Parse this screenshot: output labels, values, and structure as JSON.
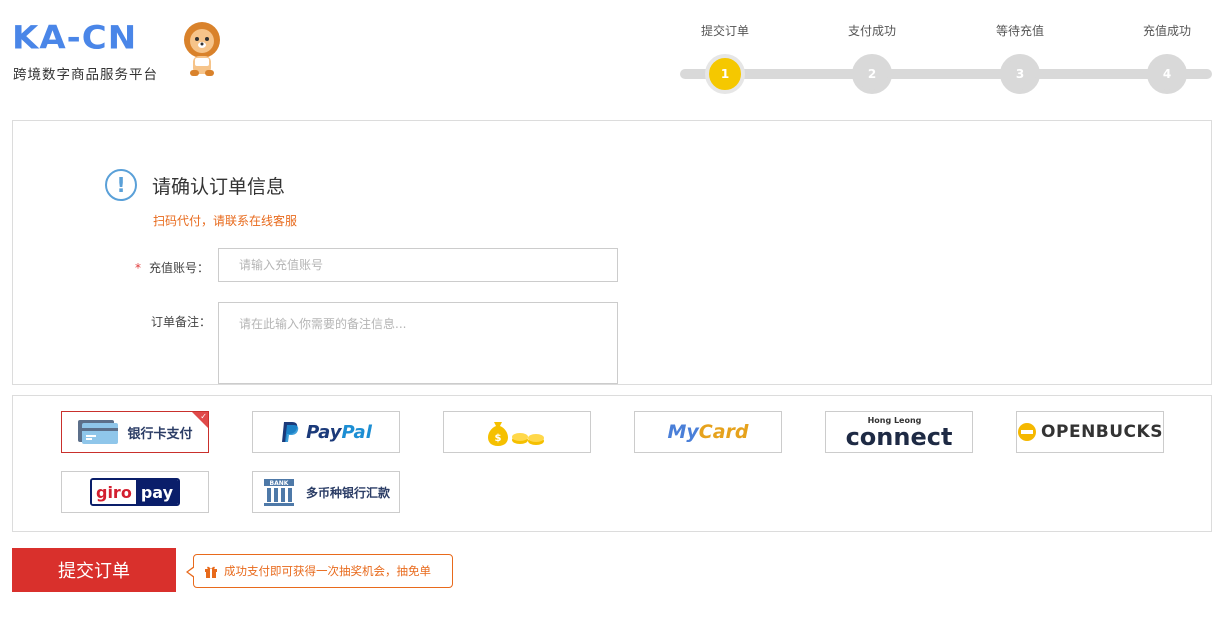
{
  "brand": {
    "logo_text": "KA-CN",
    "subtitle": "跨境数字商品服务平台"
  },
  "steps": [
    {
      "label": "提交订单",
      "number": "1",
      "active": true
    },
    {
      "label": "支付成功",
      "number": "2",
      "active": false
    },
    {
      "label": "等待充值",
      "number": "3",
      "active": false
    },
    {
      "label": "充值成功",
      "number": "4",
      "active": false
    }
  ],
  "order": {
    "title": "请确认订单信息",
    "warning": "扫码代付，请联系在线客服",
    "account_label": "充值账号：",
    "account_required_mark": "*",
    "account_placeholder": "请输入充值账号",
    "account_value": "",
    "note_label": "订单备注：",
    "note_placeholder": "请在此输入你需要的备注信息...",
    "note_value": ""
  },
  "payments": {
    "bank_card": "银行卡支付",
    "paypal_pay": "Pay",
    "paypal_pal": "Pal",
    "mycard_my": "My",
    "mycard_card": "Card",
    "hongleong": "Hong Leong",
    "connect": "connect",
    "openbucks": "OPENBUCKS",
    "giro_l": "giro",
    "giro_r": "pay",
    "wire": "多币种银行汇款",
    "selected": "bank_card"
  },
  "submit": {
    "label": "提交订单",
    "promo": "成功支付即可获得一次抽奖机会，抽免单"
  },
  "colors": {
    "brand_blue": "#4a86e8",
    "step_active": "#f5c800",
    "submit_red": "#d9302c",
    "warn_orange": "#e86a1c"
  }
}
